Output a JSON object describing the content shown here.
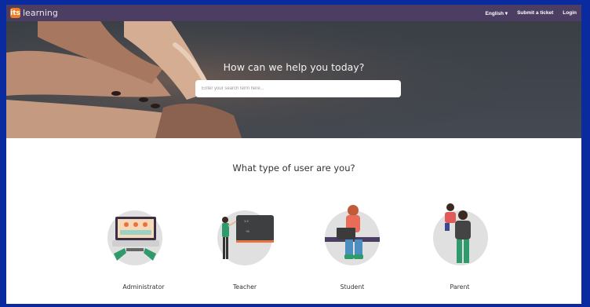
{
  "header": {
    "logo_mark": "its",
    "logo_text": "learning",
    "language": "English ▾",
    "submit_ticket": "Submit a ticket",
    "login": "Login"
  },
  "hero": {
    "title": "How can we help you today?",
    "search_placeholder": "Enter your search term here..."
  },
  "user_types": {
    "question": "What type of user are you?",
    "items": [
      {
        "label": "Administrator",
        "icon": "laptop-hands-icon"
      },
      {
        "label": "Teacher",
        "icon": "teacher-chalkboard-icon"
      },
      {
        "label": "Student",
        "icon": "student-laptop-icon"
      },
      {
        "label": "Parent",
        "icon": "parent-child-icon"
      }
    ]
  },
  "colors": {
    "topbar": "#4b3e62",
    "logo": "#f27d21",
    "frame_border": "#0a2aa0"
  }
}
